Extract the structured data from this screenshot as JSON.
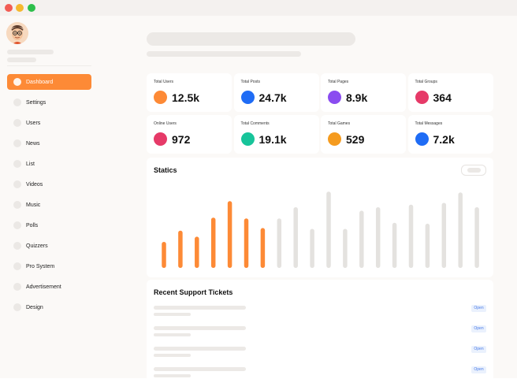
{
  "window": {
    "controls": [
      "close",
      "minimize",
      "maximize"
    ]
  },
  "sidebar": {
    "items": [
      {
        "label": "Dashboard",
        "active": true
      },
      {
        "label": "Settings"
      },
      {
        "label": "Users"
      },
      {
        "label": "News"
      },
      {
        "label": "List"
      },
      {
        "label": "Videos"
      },
      {
        "label": "Music"
      },
      {
        "label": "Polls"
      },
      {
        "label": "Quizzers"
      },
      {
        "label": "Pro System"
      },
      {
        "label": "Advertisement"
      },
      {
        "label": "Design"
      }
    ]
  },
  "stats": [
    {
      "label": "Total Users",
      "value": "12.5k",
      "color": "#fd8a36"
    },
    {
      "label": "Total Posts",
      "value": "24.7k",
      "color": "#1f6cf5"
    },
    {
      "label": "Total Pages",
      "value": "8.9k",
      "color": "#8a4cf0"
    },
    {
      "label": "Total Groups",
      "value": "364",
      "color": "#e63a68"
    },
    {
      "label": "Online Users",
      "value": "972",
      "color": "#e63a68"
    },
    {
      "label": "Total Comments",
      "value": "19.1k",
      "color": "#17c49a"
    },
    {
      "label": "Total Games",
      "value": "529",
      "color": "#f59b1f"
    },
    {
      "label": "Total Messages",
      "value": "7.2k",
      "color": "#1f6cf5"
    }
  ],
  "statics": {
    "title": "Statics",
    "highlight_color": "#fd8a36",
    "muted_color": "#e4e2df"
  },
  "chart_data": {
    "type": "bar",
    "title": "Statics",
    "values": [
      30,
      43,
      36,
      58,
      77,
      57,
      46,
      57,
      70,
      45,
      88,
      45,
      66,
      70,
      52,
      73,
      51,
      75,
      87,
      70
    ],
    "highlighted_count": 7,
    "ylim": [
      0,
      100
    ]
  },
  "tickets": {
    "title": "Recent Support Tickets",
    "items": [
      {
        "status": "Open"
      },
      {
        "status": "Open"
      },
      {
        "status": "Open"
      },
      {
        "status": "Open"
      }
    ]
  }
}
